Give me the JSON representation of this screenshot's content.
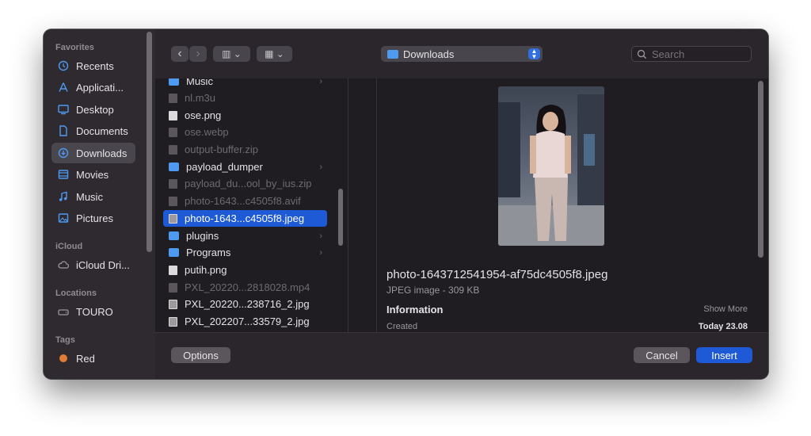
{
  "sidebar": {
    "favorites_label": "Favorites",
    "favorites": [
      {
        "label": "Recents",
        "icon": "clock-icon"
      },
      {
        "label": "Applicati...",
        "icon": "applications-icon"
      },
      {
        "label": "Desktop",
        "icon": "desktop-icon"
      },
      {
        "label": "Documents",
        "icon": "document-icon"
      },
      {
        "label": "Downloads",
        "icon": "downloads-icon",
        "selected": true
      },
      {
        "label": "Movies",
        "icon": "film-icon"
      },
      {
        "label": "Music",
        "icon": "music-icon"
      },
      {
        "label": "Pictures",
        "icon": "pictures-icon"
      }
    ],
    "icloud_label": "iCloud",
    "icloud": [
      {
        "label": "iCloud Dri...",
        "icon": "cloud-icon"
      }
    ],
    "locations_label": "Locations",
    "locations": [
      {
        "label": "TOURO",
        "icon": "disk-icon"
      }
    ],
    "tags_label": "Tags",
    "tags": [
      {
        "label": "Red",
        "color": "#e07a35"
      }
    ]
  },
  "toolbar": {
    "back": "‹",
    "forward": "›",
    "view_columns": "▥ ⌄",
    "view_grid": "▦ ⌄",
    "location": "Downloads",
    "search_placeholder": "Search"
  },
  "files": [
    {
      "name": "Music",
      "type": "folder",
      "dim": false,
      "chevron": true
    },
    {
      "name": "nl.m3u",
      "type": "doc",
      "dim": true
    },
    {
      "name": "ose.png",
      "type": "doc",
      "dim": false
    },
    {
      "name": "ose.webp",
      "type": "doc",
      "dim": true
    },
    {
      "name": "output-buffer.zip",
      "type": "doc",
      "dim": true
    },
    {
      "name": "payload_dumper",
      "type": "folder",
      "dim": false,
      "chevron": true
    },
    {
      "name": "payload_du...ool_by_ius.zip",
      "type": "doc",
      "dim": true
    },
    {
      "name": "photo-1643...c4505f8.avif",
      "type": "doc",
      "dim": true
    },
    {
      "name": "photo-1643...c4505f8.jpeg",
      "type": "img",
      "dim": false,
      "selected": true
    },
    {
      "name": "plugins",
      "type": "folder",
      "dim": false,
      "chevron": true
    },
    {
      "name": "Programs",
      "type": "folder",
      "dim": false,
      "chevron": true
    },
    {
      "name": "putih.png",
      "type": "doc",
      "dim": false
    },
    {
      "name": "PXL_20220...2818028.mp4",
      "type": "doc",
      "dim": true
    },
    {
      "name": "PXL_20220...238716_2.jpg",
      "type": "img",
      "dim": false
    },
    {
      "name": "PXL_202207...33579_2.jpg",
      "type": "img",
      "dim": false
    }
  ],
  "preview": {
    "filename": "photo-1643712541954-af75dc4505f8.jpeg",
    "kind": "JPEG image - 309 KB",
    "info_label": "Information",
    "show_more": "Show More",
    "created_label": "Created",
    "created_value": "Today 23.08"
  },
  "buttons": {
    "options": "Options",
    "cancel": "Cancel",
    "insert": "Insert"
  }
}
